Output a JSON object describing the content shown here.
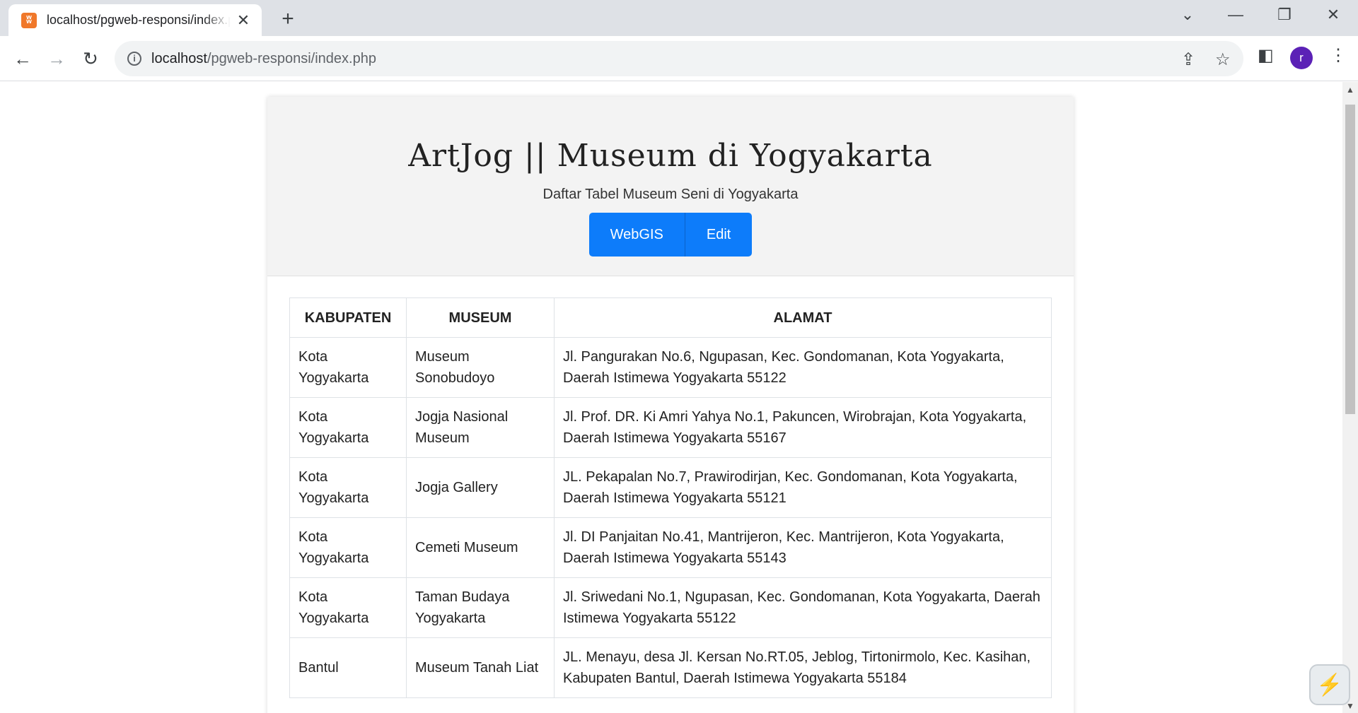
{
  "browser": {
    "tab_title": "localhost/pgweb-responsi/index.php",
    "tab_close": "✕",
    "new_tab": "+",
    "url_host": "localhost",
    "url_path": "/pgweb-responsi/index.php",
    "profile_initial": "r",
    "accent_color": "#5b21b6"
  },
  "page": {
    "title": "ArtJog || Museum di Yogyakarta",
    "subtitle": "Daftar Tabel Museum Seni di Yogyakarta",
    "buttons": [
      "WebGIS",
      "Edit"
    ],
    "button_color": "#0d7cfa"
  },
  "table": {
    "headers": [
      "KABUPATEN",
      "MUSEUM",
      "ALAMAT"
    ],
    "rows": [
      {
        "kabupaten": "Kota Yogyakarta",
        "museum": "Museum Sonobudoyo",
        "alamat": "Jl. Pangurakan No.6, Ngupasan, Kec. Gondomanan, Kota Yogyakarta, Daerah Istimewa Yogyakarta 55122"
      },
      {
        "kabupaten": "Kota Yogyakarta",
        "museum": "Jogja Nasional Museum",
        "alamat": "Jl. Prof. DR. Ki Amri Yahya No.1, Pakuncen, Wirobrajan, Kota Yogyakarta, Daerah Istimewa Yogyakarta 55167"
      },
      {
        "kabupaten": "Kota Yogyakarta",
        "museum": "Jogja Gallery",
        "alamat": "JL. Pekapalan No.7, Prawirodirjan, Kec. Gondomanan, Kota Yogyakarta, Daerah Istimewa Yogyakarta 55121"
      },
      {
        "kabupaten": "Kota Yogyakarta",
        "museum": "Cemeti Museum",
        "alamat": "Jl. DI Panjaitan No.41, Mantrijeron, Kec. Mantrijeron, Kota Yogyakarta, Daerah Istimewa Yogyakarta 55143"
      },
      {
        "kabupaten": "Kota Yogyakarta",
        "museum": "Taman Budaya Yogyakarta",
        "alamat": "Jl. Sriwedani No.1, Ngupasan, Kec. Gondomanan, Kota Yogyakarta, Daerah Istimewa Yogyakarta 55122"
      },
      {
        "kabupaten": "Bantul",
        "museum": "Museum Tanah Liat",
        "alamat": "JL. Menayu, desa Jl. Kersan No.RT.05, Jeblog, Tirtonirmolo, Kec. Kasihan, Kabupaten Bantul, Daerah Istimewa Yogyakarta 55184"
      }
    ]
  }
}
